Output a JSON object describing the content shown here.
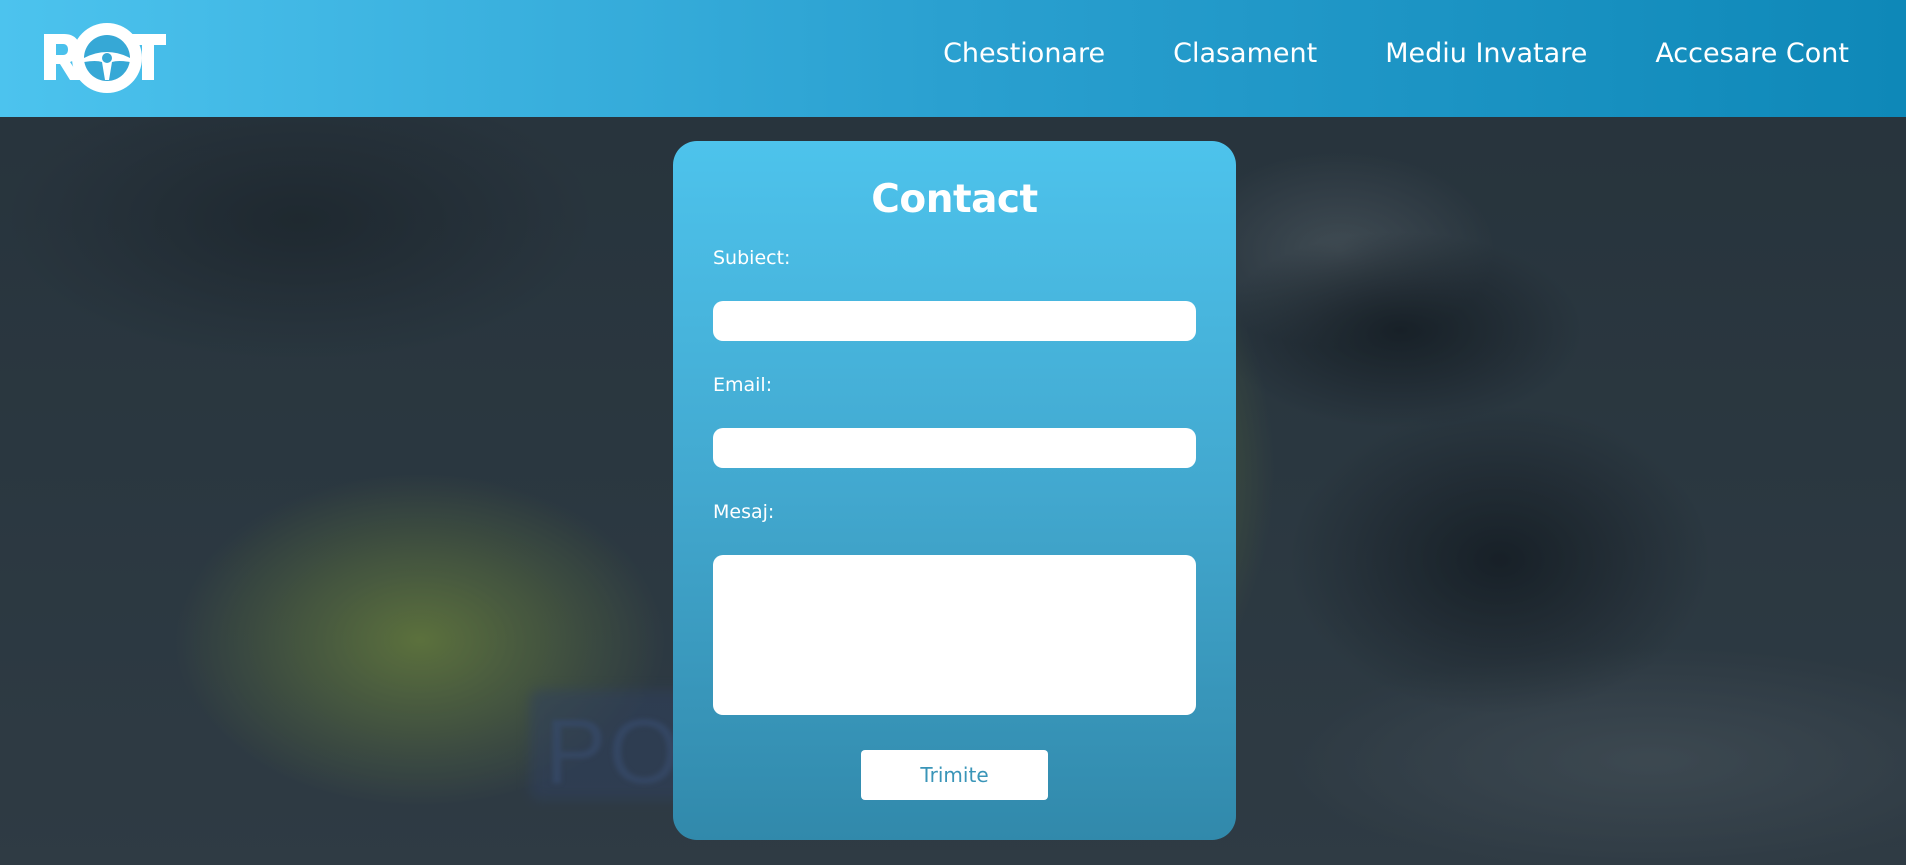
{
  "header": {
    "logo_text": "ROT",
    "nav": [
      {
        "label": "Chestionare"
      },
      {
        "label": "Clasament"
      },
      {
        "label": "Mediu Invatare"
      },
      {
        "label": "Accesare Cont"
      }
    ]
  },
  "background": {
    "patch_text": "PO"
  },
  "contact_form": {
    "title": "Contact",
    "fields": {
      "subject": {
        "label": "Subiect:",
        "value": ""
      },
      "email": {
        "label": "Email:",
        "value": ""
      },
      "message": {
        "label": "Mesaj:",
        "value": ""
      }
    },
    "submit_label": "Trimite"
  },
  "colors": {
    "header_start": "#4cc3ee",
    "header_end": "#0e88b8",
    "card_top": "#4dc3ec",
    "card_bottom": "#3189ab",
    "button_text": "#3a95b8"
  }
}
